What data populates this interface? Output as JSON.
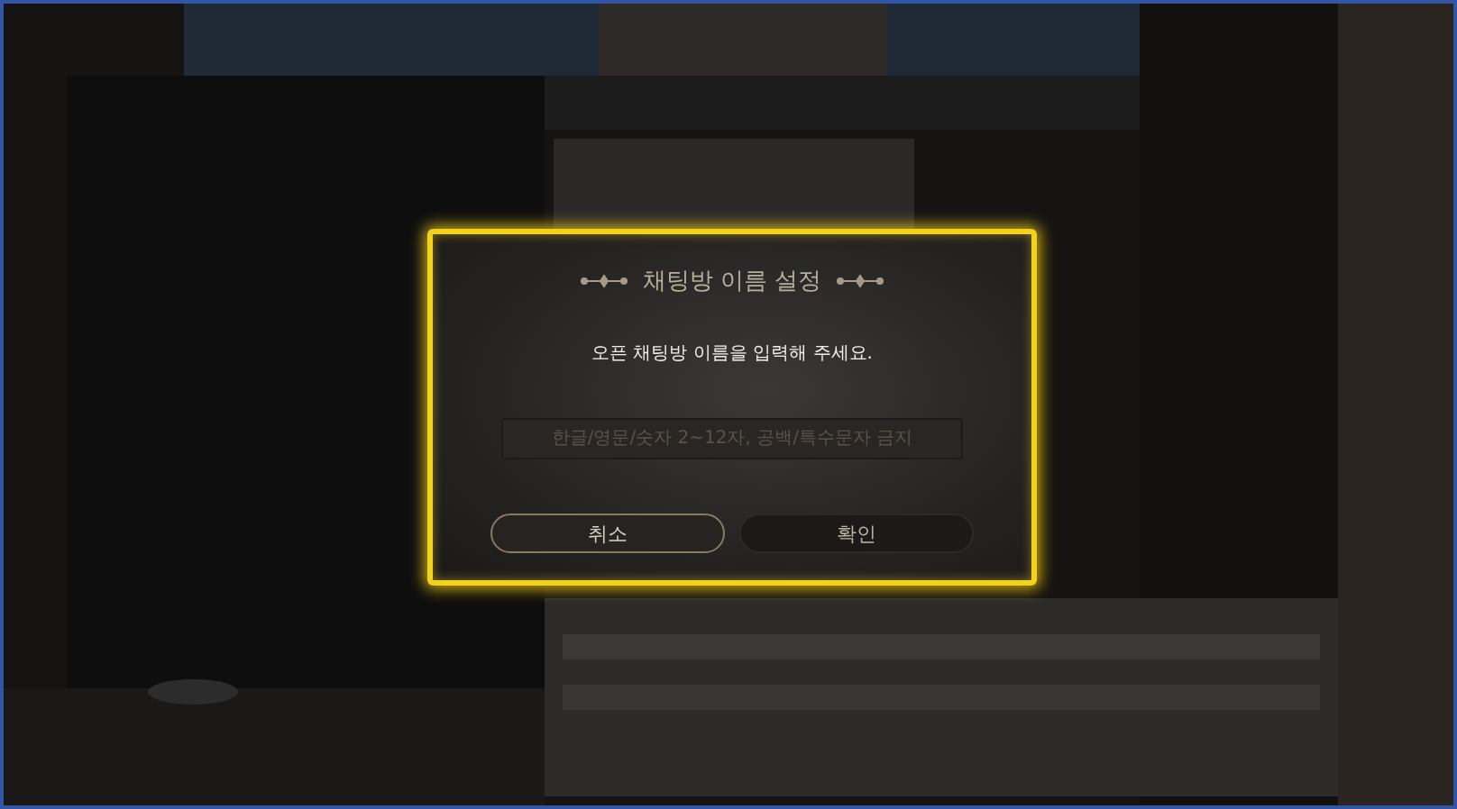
{
  "dialog": {
    "title": "채팅방 이름 설정",
    "message": "오픈 채팅방 이름을 입력해 주세요.",
    "name_field": {
      "placeholder": "한글/영문/숫자 2~12자, 공백/특수문자 금지"
    },
    "buttons": [
      {
        "label": "취소",
        "kind": "outlined"
      },
      {
        "label": "확인",
        "kind": "filled"
      }
    ]
  }
}
